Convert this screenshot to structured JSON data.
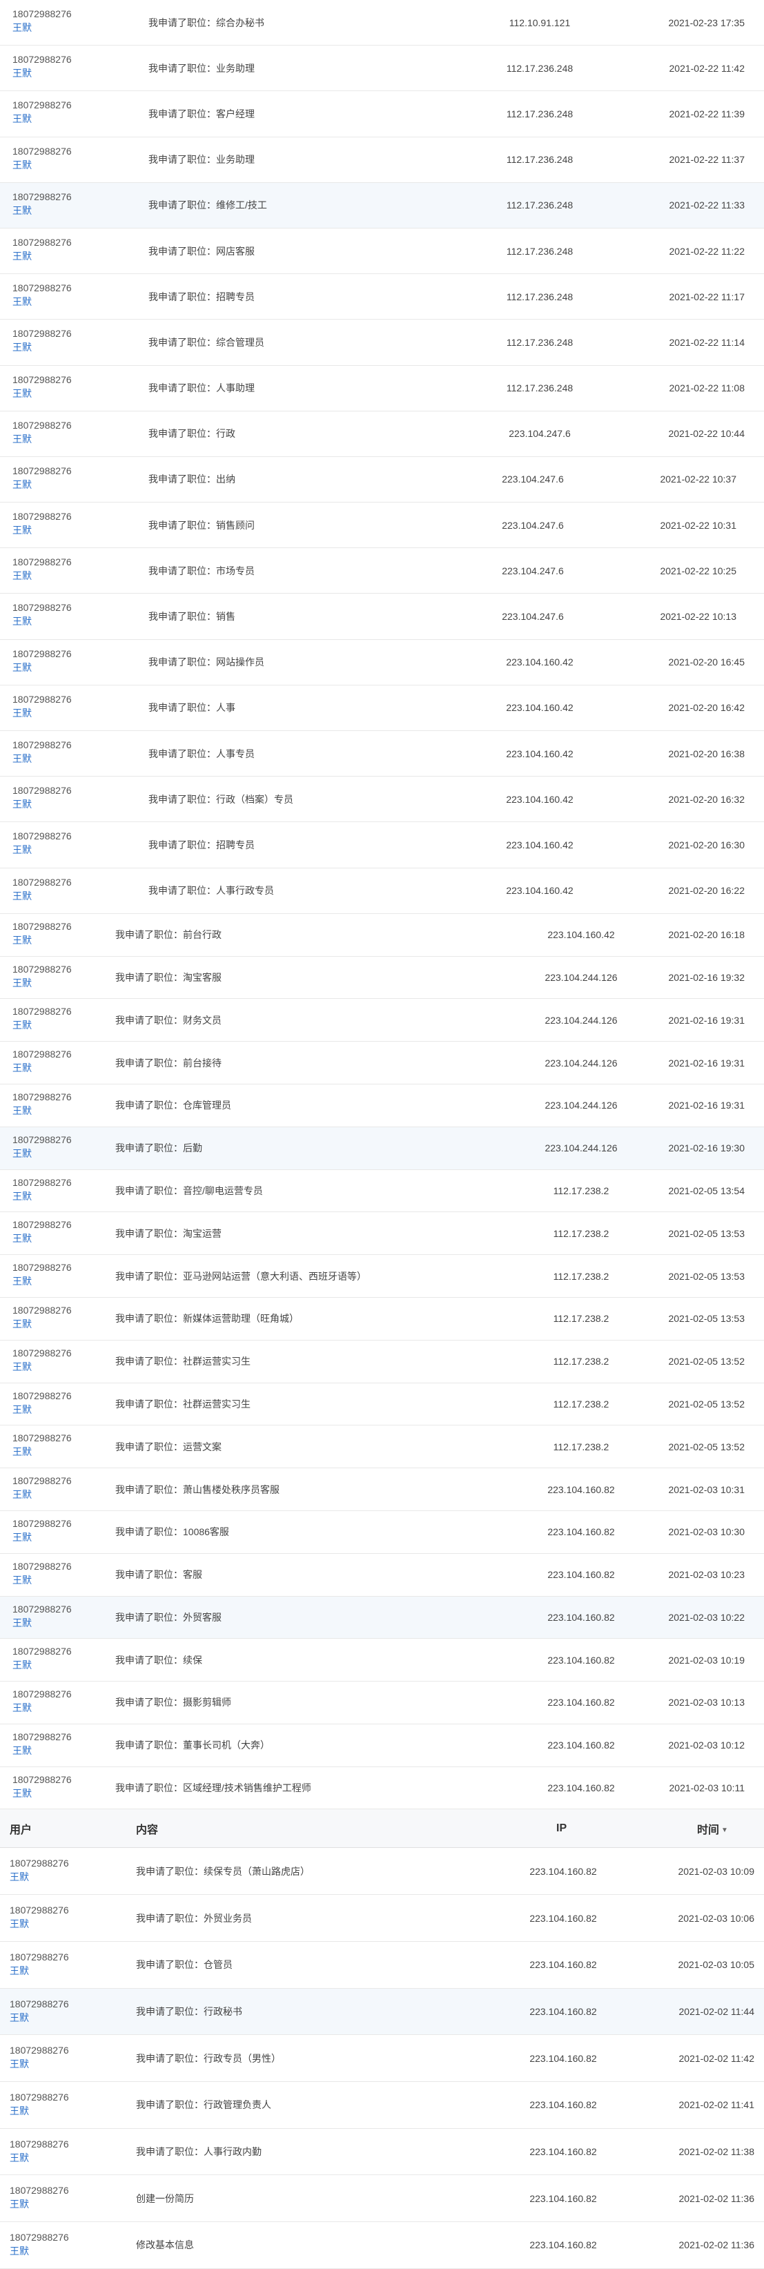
{
  "header": {
    "user": "用户",
    "content": "内容",
    "ip": "IP",
    "time": "时间"
  },
  "rowsA": [
    {
      "phone": "18072988276",
      "name": "王默",
      "content": "我申请了职位：综合办秘书",
      "ip": "112.10.91.121",
      "time": "2021-02-23 17:35"
    },
    {
      "phone": "18072988276",
      "name": "王默",
      "content": "我申请了职位：业务助理",
      "ip": "112.17.236.248",
      "time": "2021-02-22 11:42"
    },
    {
      "phone": "18072988276",
      "name": "王默",
      "content": "我申请了职位：客户经理",
      "ip": "112.17.236.248",
      "time": "2021-02-22 11:39"
    },
    {
      "phone": "18072988276",
      "name": "王默",
      "content": "我申请了职位：业务助理",
      "ip": "112.17.236.248",
      "time": "2021-02-22 11:37"
    },
    {
      "phone": "18072988276",
      "name": "王默",
      "content": "我申请了职位：维修工/技工",
      "ip": "112.17.236.248",
      "time": "2021-02-22 11:33"
    },
    {
      "phone": "18072988276",
      "name": "王默",
      "content": "我申请了职位：网店客服",
      "ip": "112.17.236.248",
      "time": "2021-02-22 11:22"
    },
    {
      "phone": "18072988276",
      "name": "王默",
      "content": "我申请了职位：招聘专员",
      "ip": "112.17.236.248",
      "time": "2021-02-22 11:17"
    },
    {
      "phone": "18072988276",
      "name": "王默",
      "content": "我申请了职位：综合管理员",
      "ip": "112.17.236.248",
      "time": "2021-02-22 11:14"
    },
    {
      "phone": "18072988276",
      "name": "王默",
      "content": "我申请了职位：人事助理",
      "ip": "112.17.236.248",
      "time": "2021-02-22 11:08"
    },
    {
      "phone": "18072988276",
      "name": "王默",
      "content": "我申请了职位：行政",
      "ip": "223.104.247.6",
      "time": "2021-02-22 10:44"
    },
    {
      "phone": "18072988276",
      "name": "王默",
      "content": "我申请了职位：出纳",
      "ip": "223.104.247.6",
      "time": "2021-02-22 10:37"
    },
    {
      "phone": "18072988276",
      "name": "王默",
      "content": "我申请了职位：销售顾问",
      "ip": "223.104.247.6",
      "time": "2021-02-22 10:31"
    },
    {
      "phone": "18072988276",
      "name": "王默",
      "content": "我申请了职位：市场专员",
      "ip": "223.104.247.6",
      "time": "2021-02-22 10:25"
    },
    {
      "phone": "18072988276",
      "name": "王默",
      "content": "我申请了职位：销售",
      "ip": "223.104.247.6",
      "time": "2021-02-22 10:13"
    },
    {
      "phone": "18072988276",
      "name": "王默",
      "content": "我申请了职位：网站操作员",
      "ip": "223.104.160.42",
      "time": "2021-02-20 16:45"
    },
    {
      "phone": "18072988276",
      "name": "王默",
      "content": "我申请了职位：人事",
      "ip": "223.104.160.42",
      "time": "2021-02-20 16:42"
    },
    {
      "phone": "18072988276",
      "name": "王默",
      "content": "我申请了职位：人事专员",
      "ip": "223.104.160.42",
      "time": "2021-02-20 16:38"
    },
    {
      "phone": "18072988276",
      "name": "王默",
      "content": "我申请了职位：行政（档案）专员",
      "ip": "223.104.160.42",
      "time": "2021-02-20 16:32"
    },
    {
      "phone": "18072988276",
      "name": "王默",
      "content": "我申请了职位：招聘专员",
      "ip": "223.104.160.42",
      "time": "2021-02-20 16:30"
    },
    {
      "phone": "18072988276",
      "name": "王默",
      "content": "我申请了职位：人事行政专员",
      "ip": "223.104.160.42",
      "time": "2021-02-20 16:22"
    }
  ],
  "rowsB": [
    {
      "phone": "18072988276",
      "name": "王默",
      "content": "我申请了职位：前台行政",
      "ip": "223.104.160.42",
      "time": "2021-02-20 16:18"
    },
    {
      "phone": "18072988276",
      "name": "王默",
      "content": "我申请了职位：淘宝客服",
      "ip": "223.104.244.126",
      "time": "2021-02-16 19:32"
    },
    {
      "phone": "18072988276",
      "name": "王默",
      "content": "我申请了职位：财务文员",
      "ip": "223.104.244.126",
      "time": "2021-02-16 19:31"
    },
    {
      "phone": "18072988276",
      "name": "王默",
      "content": "我申请了职位：前台接待",
      "ip": "223.104.244.126",
      "time": "2021-02-16 19:31"
    },
    {
      "phone": "18072988276",
      "name": "王默",
      "content": "我申请了职位：仓库管理员",
      "ip": "223.104.244.126",
      "time": "2021-02-16 19:31"
    },
    {
      "phone": "18072988276",
      "name": "王默",
      "content": "我申请了职位：后勤",
      "ip": "223.104.244.126",
      "time": "2021-02-16 19:30"
    },
    {
      "phone": "18072988276",
      "name": "王默",
      "content": "我申请了职位：音控/聊电运营专员",
      "ip": "112.17.238.2",
      "time": "2021-02-05 13:54"
    },
    {
      "phone": "18072988276",
      "name": "王默",
      "content": "我申请了职位：淘宝运营",
      "ip": "112.17.238.2",
      "time": "2021-02-05 13:53"
    },
    {
      "phone": "18072988276",
      "name": "王默",
      "content": "我申请了职位：亚马逊网站运营（意大利语、西班牙语等）",
      "ip": "112.17.238.2",
      "time": "2021-02-05 13:53"
    },
    {
      "phone": "18072988276",
      "name": "王默",
      "content": "我申请了职位：新媒体运营助理（旺角城）",
      "ip": "112.17.238.2",
      "time": "2021-02-05 13:53"
    },
    {
      "phone": "18072988276",
      "name": "王默",
      "content": "我申请了职位：社群运营实习生",
      "ip": "112.17.238.2",
      "time": "2021-02-05 13:52"
    },
    {
      "phone": "18072988276",
      "name": "王默",
      "content": "我申请了职位：社群运营实习生",
      "ip": "112.17.238.2",
      "time": "2021-02-05 13:52"
    },
    {
      "phone": "18072988276",
      "name": "王默",
      "content": "我申请了职位：运营文案",
      "ip": "112.17.238.2",
      "time": "2021-02-05 13:52"
    },
    {
      "phone": "18072988276",
      "name": "王默",
      "content": "我申请了职位：萧山售楼处秩序员客服",
      "ip": "223.104.160.82",
      "time": "2021-02-03 10:31"
    },
    {
      "phone": "18072988276",
      "name": "王默",
      "content": "我申请了职位：10086客服",
      "ip": "223.104.160.82",
      "time": "2021-02-03 10:30"
    },
    {
      "phone": "18072988276",
      "name": "王默",
      "content": "我申请了职位：客服",
      "ip": "223.104.160.82",
      "time": "2021-02-03 10:23"
    },
    {
      "phone": "18072988276",
      "name": "王默",
      "content": "我申请了职位：外贸客服",
      "ip": "223.104.160.82",
      "time": "2021-02-03 10:22"
    },
    {
      "phone": "18072988276",
      "name": "王默",
      "content": "我申请了职位：续保",
      "ip": "223.104.160.82",
      "time": "2021-02-03 10:19"
    },
    {
      "phone": "18072988276",
      "name": "王默",
      "content": "我申请了职位：摄影剪辑师",
      "ip": "223.104.160.82",
      "time": "2021-02-03 10:13"
    },
    {
      "phone": "18072988276",
      "name": "王默",
      "content": "我申请了职位：董事长司机（大奔）",
      "ip": "223.104.160.82",
      "time": "2021-02-03 10:12"
    },
    {
      "phone": "18072988276",
      "name": "王默",
      "content": "我申请了职位：区域经理/技术销售维护工程师",
      "ip": "223.104.160.82",
      "time": "2021-02-03 10:11"
    }
  ],
  "rowsC": [
    {
      "phone": "18072988276",
      "name": "王默",
      "content": "我申请了职位：续保专员（萧山路虎店）",
      "ip": "223.104.160.82",
      "time": "2021-02-03 10:09"
    },
    {
      "phone": "18072988276",
      "name": "王默",
      "content": "我申请了职位：外贸业务员",
      "ip": "223.104.160.82",
      "time": "2021-02-03 10:06"
    },
    {
      "phone": "18072988276",
      "name": "王默",
      "content": "我申请了职位：仓管员",
      "ip": "223.104.160.82",
      "time": "2021-02-03 10:05"
    },
    {
      "phone": "18072988276",
      "name": "王默",
      "content": "我申请了职位：行政秘书",
      "ip": "223.104.160.82",
      "time": "2021-02-02 11:44"
    },
    {
      "phone": "18072988276",
      "name": "王默",
      "content": "我申请了职位：行政专员（男性）",
      "ip": "223.104.160.82",
      "time": "2021-02-02 11:42"
    },
    {
      "phone": "18072988276",
      "name": "王默",
      "content": "我申请了职位：行政管理负责人",
      "ip": "223.104.160.82",
      "time": "2021-02-02 11:41"
    },
    {
      "phone": "18072988276",
      "name": "王默",
      "content": "我申请了职位：人事行政内勤",
      "ip": "223.104.160.82",
      "time": "2021-02-02 11:38"
    },
    {
      "phone": "18072988276",
      "name": "王默",
      "content": "创建一份简历",
      "ip": "223.104.160.82",
      "time": "2021-02-02 11:36"
    },
    {
      "phone": "18072988276",
      "name": "王默",
      "content": "修改基本信息",
      "ip": "223.104.160.82",
      "time": "2021-02-02 11:36"
    }
  ]
}
